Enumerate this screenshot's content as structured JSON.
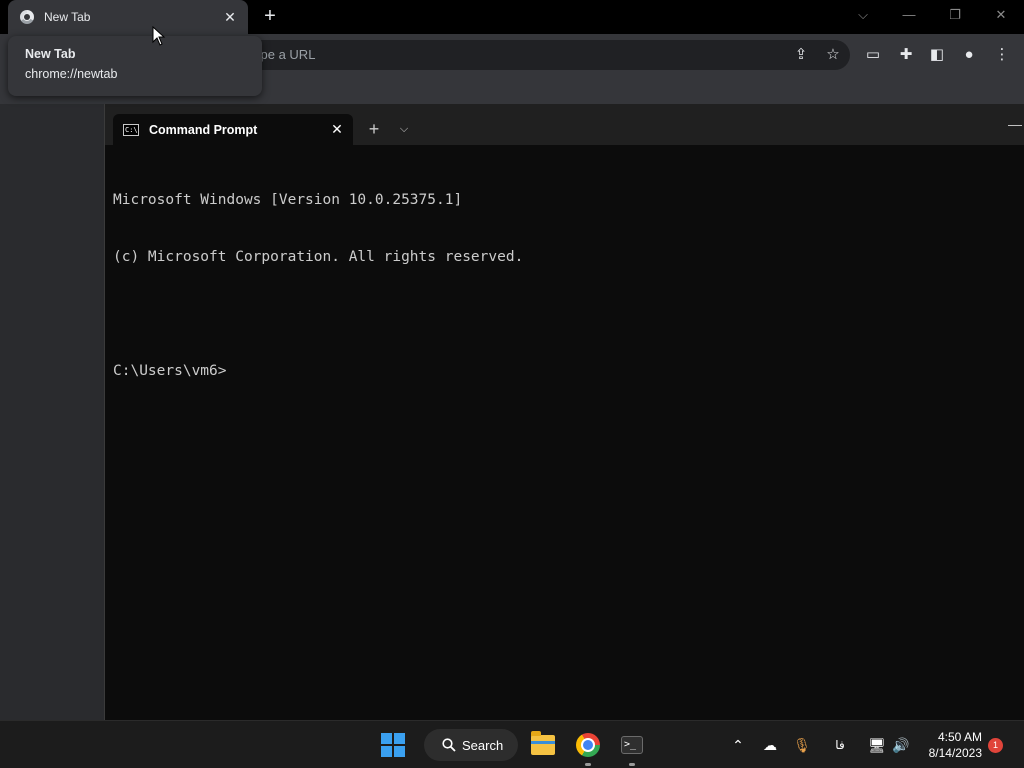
{
  "browser": {
    "tab": {
      "title": "New Tab"
    },
    "hover_card": {
      "title": "New Tab",
      "url": "chrome://newtab"
    },
    "omnibox": {
      "text": "ype a URL"
    },
    "toolbar_icons": [
      "share-icon",
      "bookmark-star-icon",
      "cast-icon",
      "extensions-icon",
      "side-panel-icon",
      "profile-icon",
      "more-menu-icon"
    ]
  },
  "terminal": {
    "tab": {
      "title": "Command Prompt"
    },
    "lines": [
      "Microsoft Windows [Version 10.0.25375.1]",
      "(c) Microsoft Corporation. All rights reserved.",
      "",
      "C:\\Users\\vm6>"
    ]
  },
  "taskbar": {
    "search_label": "Search",
    "pinned_apps": [
      "start",
      "search",
      "file-explorer",
      "chrome",
      "terminal"
    ],
    "tray": {
      "language": "فا",
      "time": "4:50 AM",
      "date": "8/14/2023",
      "notification_count": "1"
    }
  },
  "colors": {
    "terminal_bg": "#0c0c0c",
    "terminal_text": "#cccccc",
    "windows_accent": "#3aa0f0",
    "notification_badge": "#e0443a"
  }
}
